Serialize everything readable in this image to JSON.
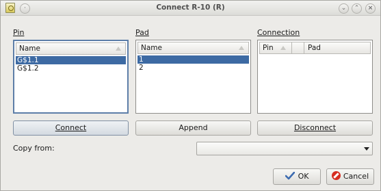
{
  "window": {
    "title": "Connect R-10 (R)",
    "controls": [
      "minimize-icon",
      "maximize-icon",
      "close-icon"
    ]
  },
  "pin": {
    "label": "Pin",
    "column_header": "Name",
    "items": [
      "G$1.1",
      "G$1.2"
    ],
    "selected_index": 0
  },
  "pad": {
    "label": "Pad",
    "column_header": "Name",
    "items": [
      "1",
      "2"
    ],
    "selected_index": 0
  },
  "connection": {
    "label": "Connection",
    "column_headers": [
      "Pin",
      "Pad"
    ],
    "rows": []
  },
  "buttons": {
    "connect": "Connect",
    "append": "Append",
    "disconnect": "Disconnect",
    "ok": "OK",
    "cancel": "Cancel"
  },
  "copy_from": {
    "label": "Copy from:",
    "value": ""
  },
  "colors": {
    "selection": "#3d6aa3",
    "focus_border": "#5d7ea8",
    "dialog_bg": "#ecebe8"
  }
}
